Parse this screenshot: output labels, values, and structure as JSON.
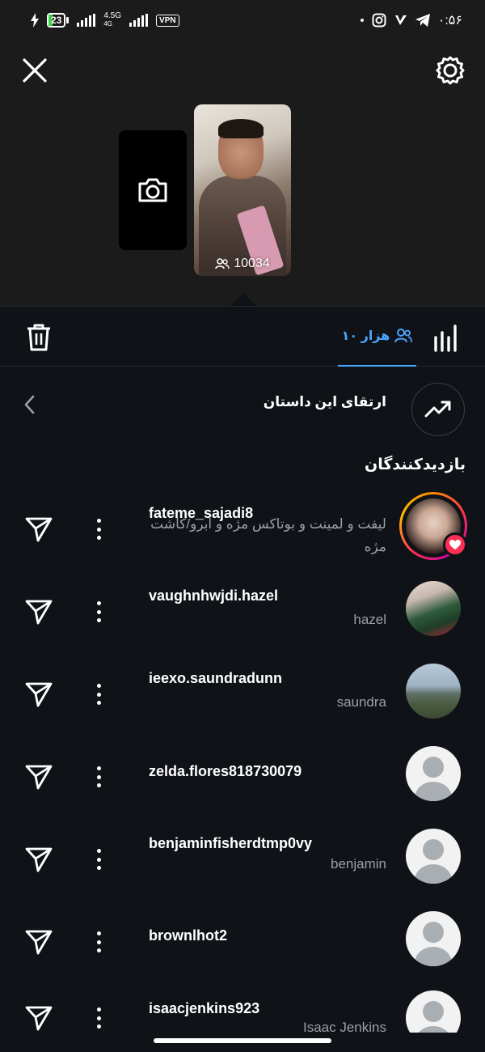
{
  "status_bar": {
    "battery": "23",
    "network": "4.5G",
    "network_sub": "4G",
    "vpn": "VPN",
    "time": "۰:۵۶"
  },
  "preview": {
    "viewer_count": "10034"
  },
  "tabs": {
    "viewers_label": "۱۰ هزار"
  },
  "boost": {
    "label": "ارتقای این داستان"
  },
  "section_title": "بازدیدکنندگان",
  "viewers": [
    {
      "username": "fateme_sajadi8",
      "fullname": "لیفت و لمینت و بوتاکس مژه و ابرو/کاشت مژه"
    },
    {
      "username": "vaughnhwjdi.hazel",
      "fullname": "hazel"
    },
    {
      "username": "ieexo.saundradunn",
      "fullname": "saundra"
    },
    {
      "username": "zelda.flores818730079",
      "fullname": ""
    },
    {
      "username": "benjaminfisherdtmp0vy",
      "fullname": "benjamin"
    },
    {
      "username": "brownlhot2",
      "fullname": ""
    },
    {
      "username": "isaacjenkins923",
      "fullname": "Isaac Jenkins"
    }
  ],
  "colors": {
    "background": "#0f1217",
    "accent": "#4aa6ff",
    "secondary_text": "#9aa0a8"
  }
}
